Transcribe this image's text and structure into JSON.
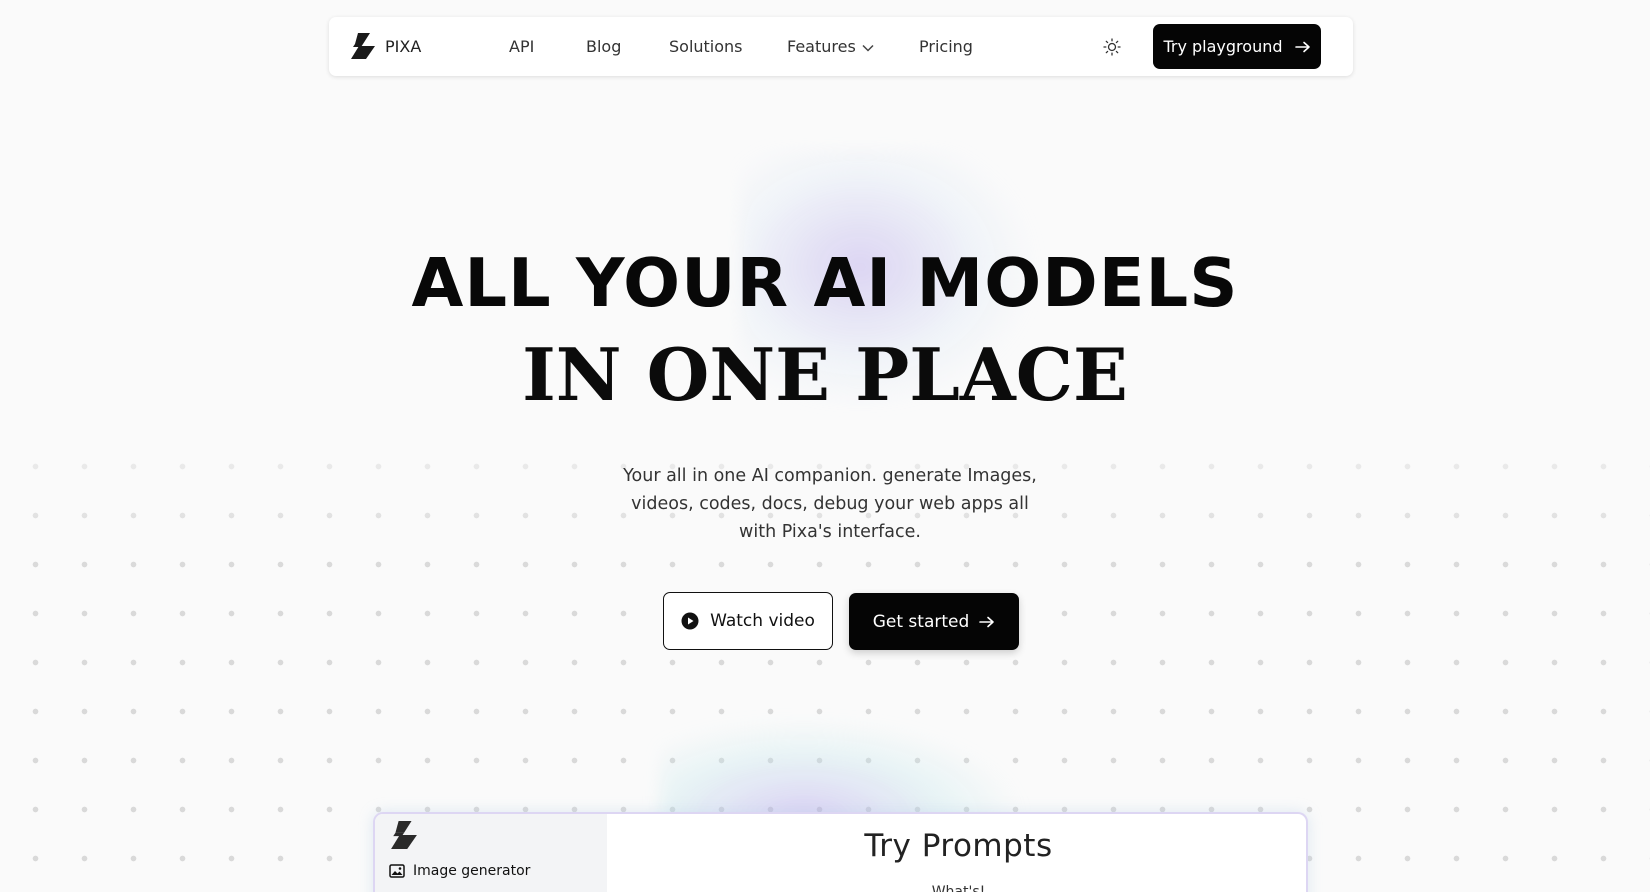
{
  "nav": {
    "brand": "PIXA",
    "links": [
      "API",
      "Blog",
      "Solutions",
      "Features",
      "Pricing"
    ],
    "features_has_dropdown": true,
    "theme_icon": "sun-icon",
    "cta_label": "Try playground",
    "cta_icon": "arrow-right-icon"
  },
  "hero": {
    "title_line1": "ALL YOUR AI MODELS",
    "title_line2": "IN ONE PLACE",
    "subtitle": "Your all in one AI companion. generate Images, videos, codes, docs, debug your web apps all with Pixa's interface.",
    "watch_label": "Watch video",
    "watch_icon": "play-circle-icon",
    "start_label": "Get started",
    "start_icon": "arrow-right-icon"
  },
  "preview": {
    "sidebar_item": "Image generator",
    "sidebar_item_icon": "image-icon",
    "title": "Try Prompts",
    "partial_text": "What's!"
  },
  "colors": {
    "primary": "#050505",
    "background": "#fafafa",
    "glow_purple": "#aa96e6",
    "glow_cyan": "#bee6eb"
  }
}
